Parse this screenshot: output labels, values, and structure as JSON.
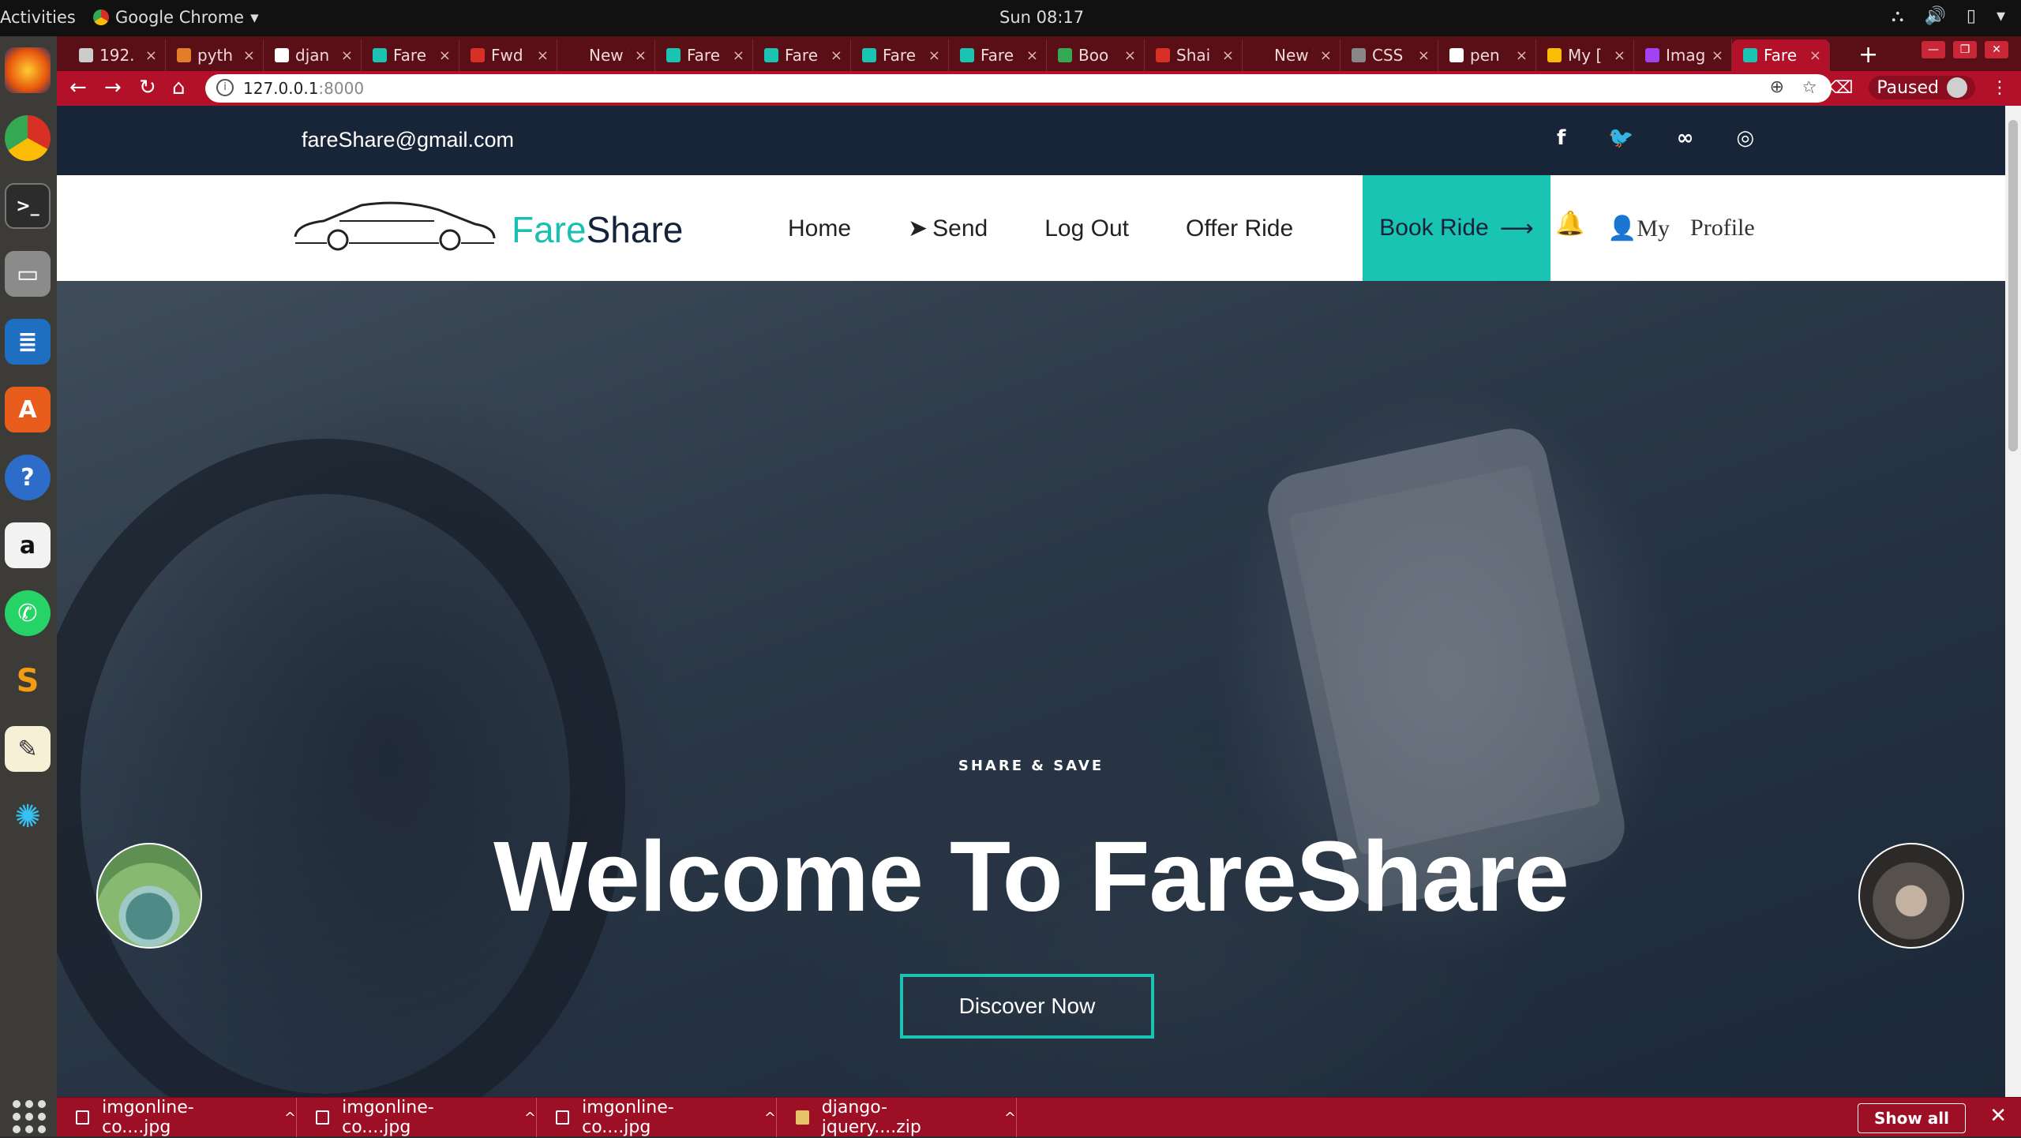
{
  "os": {
    "activities": "Activities",
    "app_name": "Google Chrome",
    "clock": "Sun 08:17"
  },
  "browser": {
    "tabs": [
      {
        "label": "192.",
        "color": "#cccccc"
      },
      {
        "label": "pyth",
        "color": "#e47d2a"
      },
      {
        "label": "djan",
        "color": "#ffffff"
      },
      {
        "label": "Fare",
        "color": "#19c4b3"
      },
      {
        "label": "Fwd",
        "color": "#d93025"
      },
      {
        "label": "New Tal",
        "color": "#5a0f17"
      },
      {
        "label": "Fare",
        "color": "#19c4b3"
      },
      {
        "label": "Fare",
        "color": "#19c4b3"
      },
      {
        "label": "Fare",
        "color": "#19c4b3"
      },
      {
        "label": "Fare",
        "color": "#19c4b3"
      },
      {
        "label": "Boo",
        "color": "#34a853"
      },
      {
        "label": "Shai",
        "color": "#d93025"
      },
      {
        "label": "New Tal",
        "color": "#5a0f17"
      },
      {
        "label": "CSS",
        "color": "#888888"
      },
      {
        "label": "pen",
        "color": "#ffffff"
      },
      {
        "label": "My [",
        "color": "#fbbc05"
      },
      {
        "label": "Imag",
        "color": "#a142f4"
      },
      {
        "label": "Fare",
        "color": "#19c4b3"
      }
    ],
    "url_host": "127.0.0.1",
    "url_port": ":8000",
    "paused_label": "Paused"
  },
  "site": {
    "email": "fareShare@gmail.com",
    "social": [
      "f",
      "🐦",
      "∞",
      "◎"
    ],
    "brand_fare": "Fare",
    "brand_share": "Share",
    "nav": {
      "home": "Home",
      "send": "Send",
      "logout": "Log Out",
      "offer": "Offer Ride",
      "book": "Book Ride",
      "my": "My",
      "profile": "Profile"
    },
    "hero": {
      "kicker": "SHARE & SAVE",
      "title": "Welcome To FareShare",
      "cta": "Discover Now"
    },
    "accent": "#19c4b3",
    "dark": "#182538"
  },
  "downloads": {
    "items": [
      {
        "name": "imgonline-co....jpg",
        "type": "image"
      },
      {
        "name": "imgonline-co....jpg",
        "type": "image"
      },
      {
        "name": "imgonline-co....jpg",
        "type": "image"
      },
      {
        "name": "django-jquery....zip",
        "type": "zip"
      }
    ],
    "show_all": "Show all"
  }
}
